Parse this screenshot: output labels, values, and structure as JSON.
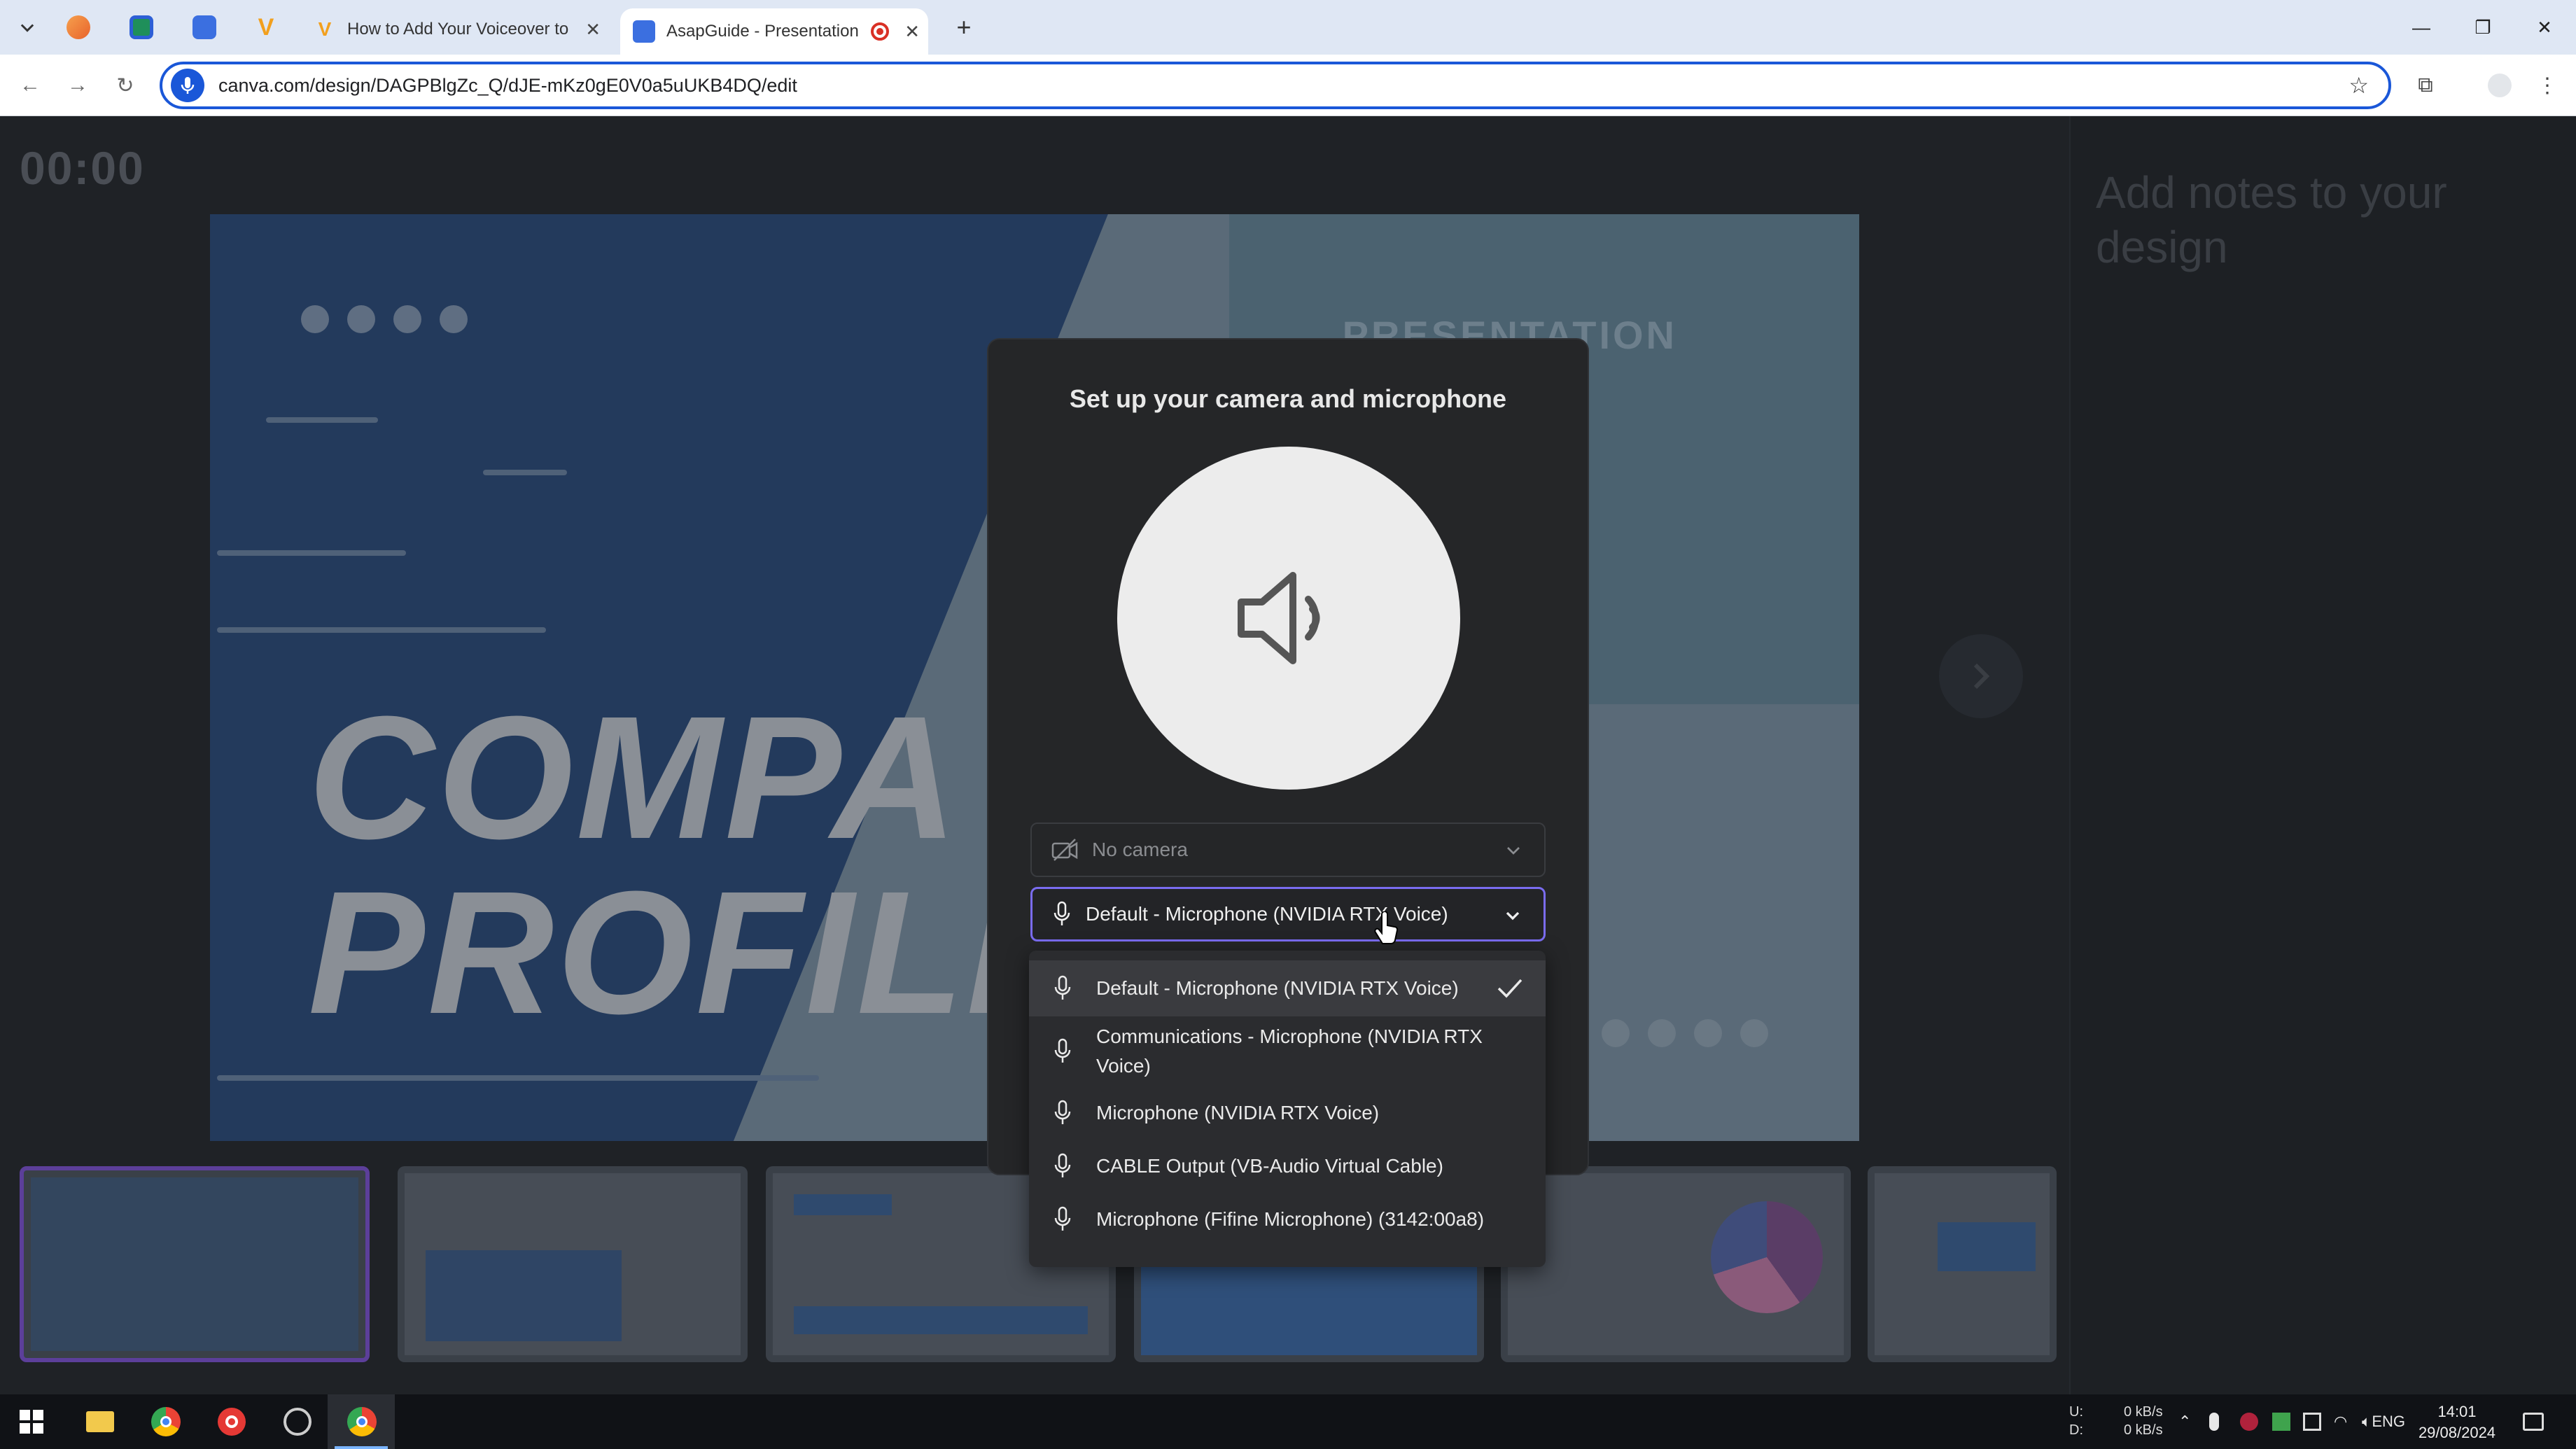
{
  "browser": {
    "tabs": [
      {
        "title": "How to Add Your Voiceover to",
        "favicon": "V",
        "active": false
      },
      {
        "title": "AsapGuide - Presentation",
        "favicon": "canva-logo-icon",
        "active": true,
        "recording": true
      }
    ],
    "url": "canva.com/design/DAGPBlgZc_Q/dJE-mKz0gE0V0a5uUKB4DQ/edit"
  },
  "presenter": {
    "timer": "00:00",
    "notes_placeholder": "Add notes to your design",
    "slide": {
      "headline_line1": "COMPA",
      "headline_line2": "PROFILE",
      "subtitle": "PRESENTATION"
    }
  },
  "modal": {
    "title": "Set up your camera and microphone",
    "camera_select": {
      "value": "No camera",
      "icon": "camera-off-icon"
    },
    "mic_select": {
      "value": "Default - Microphone (NVIDIA RTX Voice)",
      "icon": "microphone-icon"
    }
  },
  "mic_options": [
    {
      "label": "Default - Microphone (NVIDIA RTX Voice)",
      "selected": true
    },
    {
      "label": "Communications - Microphone (NVIDIA RTX Voice)",
      "selected": false
    },
    {
      "label": "Microphone (NVIDIA RTX Voice)",
      "selected": false
    },
    {
      "label": "CABLE Output (VB-Audio Virtual Cable)",
      "selected": false
    },
    {
      "label": "Microphone (Fifine Microphone) (3142:00a8)",
      "selected": false
    }
  ],
  "taskbar": {
    "net_labels": [
      "U:",
      "D:"
    ],
    "net_rates": [
      "0 kB/s",
      "0 kB/s"
    ],
    "language": "ENG",
    "time": "14:01",
    "date": "29/08/2024"
  },
  "colors": {
    "accent": "#7a6cf0",
    "omnibox_border": "#1a57d8",
    "modal_bg": "#252628"
  }
}
